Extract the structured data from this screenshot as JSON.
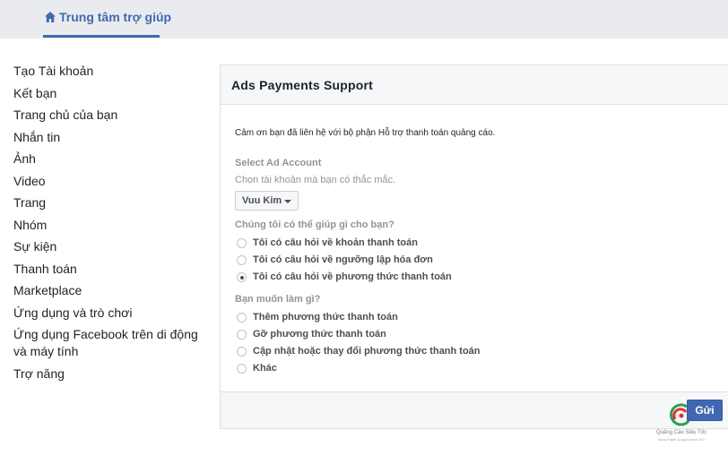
{
  "header": {
    "tab_label": "Trung tâm trợ giúp",
    "tab_icon": "home-icon",
    "accent_color": "#4267b2"
  },
  "sidebar": {
    "items": [
      {
        "label": "Tạo Tài khoản"
      },
      {
        "label": "Kết bạn"
      },
      {
        "label": "Trang chủ của bạn"
      },
      {
        "label": "Nhắn tin"
      },
      {
        "label": "Ảnh"
      },
      {
        "label": "Video"
      },
      {
        "label": "Trang"
      },
      {
        "label": "Nhóm"
      },
      {
        "label": "Sự kiện"
      },
      {
        "label": "Thanh toán"
      },
      {
        "label": "Marketplace"
      },
      {
        "label": "Ứng dụng và trò chơi"
      },
      {
        "label": "Ứng dụng Facebook trên di động và máy tính"
      },
      {
        "label": "Trợ năng"
      }
    ]
  },
  "form": {
    "title": "Ads Payments Support",
    "intro": "Cảm ơn bạn đã liên hệ với bộ phận Hỗ trợ thanh toán quảng cáo.",
    "account": {
      "label": "Select Ad Account",
      "sublabel": "Chọn tài khoản mà bạn có thắc mắc.",
      "selected": "Vuu Kim"
    },
    "help_question": {
      "label": "Chúng tôi có thể giúp gì cho bạn?",
      "options": [
        {
          "label": "Tôi có câu hỏi về khoản thanh toán",
          "checked": false
        },
        {
          "label": "Tôi có câu hỏi về ngưỡng lập hóa đơn",
          "checked": false
        },
        {
          "label": "Tôi có câu hỏi về phương thức thanh toán",
          "checked": true
        }
      ]
    },
    "action_question": {
      "label": "Bạn muốn làm gì?",
      "options": [
        {
          "label": "Thêm phương thức thanh toán",
          "checked": false
        },
        {
          "label": "Gỡ phương thức thanh toán",
          "checked": false
        },
        {
          "label": "Cập nhật hoặc thay đổi phương thức thanh toán",
          "checked": false
        },
        {
          "label": "Khác",
          "checked": false
        }
      ]
    },
    "submit_label": "Gửi"
  },
  "watermark": {
    "name": "Quảng Cáo Siêu Tốc",
    "tagline": "Đồng Hành Cùng Doanh Thu"
  }
}
